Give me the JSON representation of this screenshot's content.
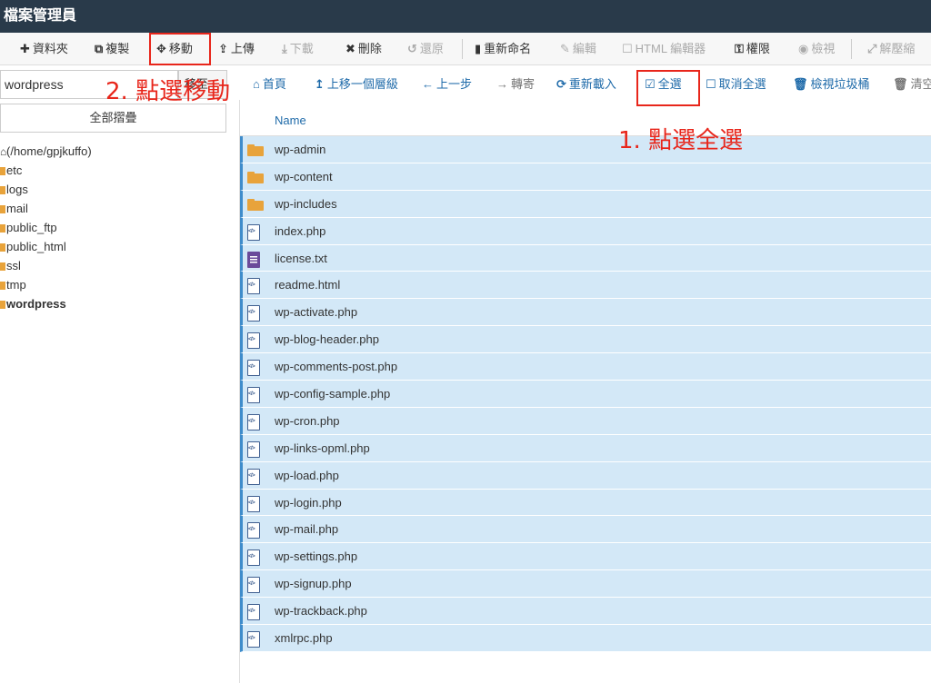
{
  "app": {
    "title": "檔案管理員"
  },
  "toolbar": {
    "new_folder": "資料夾",
    "copy": "複製",
    "move": "移動",
    "upload": "上傳",
    "download": "下載",
    "delete": "刪除",
    "restore": "還原",
    "rename": "重新命名",
    "edit": "編輯",
    "html_editor": "HTML 編輯器",
    "permissions": "權限",
    "view": "檢視",
    "extract": "解壓縮"
  },
  "sidebar": {
    "path_value": "wordpress",
    "go_label": "移至",
    "collapse_all": "全部摺疊",
    "tree": [
      {
        "label": "(/home/gpjkuffo)",
        "type": "home"
      },
      {
        "label": "etc",
        "type": "folder"
      },
      {
        "label": "logs",
        "type": "folder"
      },
      {
        "label": "mail",
        "type": "folder"
      },
      {
        "label": "public_ftp",
        "type": "folder"
      },
      {
        "label": "public_html",
        "type": "folder"
      },
      {
        "label": "ssl",
        "type": "folder"
      },
      {
        "label": "tmp",
        "type": "folder"
      },
      {
        "label": "wordpress",
        "type": "folder",
        "current": true
      }
    ]
  },
  "navbar": {
    "home": "首頁",
    "up_one_level": "上移一個層級",
    "back": "上一步",
    "forward": "轉寄",
    "reload": "重新載入",
    "select_all": "全選",
    "deselect_all": "取消全選",
    "view_trash": "檢視垃圾桶",
    "empty_trash": "清空"
  },
  "table": {
    "column_name": "Name",
    "rows": [
      {
        "name": "wp-admin",
        "type": "folder"
      },
      {
        "name": "wp-content",
        "type": "folder"
      },
      {
        "name": "wp-includes",
        "type": "folder"
      },
      {
        "name": "index.php",
        "type": "code"
      },
      {
        "name": "license.txt",
        "type": "text"
      },
      {
        "name": "readme.html",
        "type": "code"
      },
      {
        "name": "wp-activate.php",
        "type": "code"
      },
      {
        "name": "wp-blog-header.php",
        "type": "code"
      },
      {
        "name": "wp-comments-post.php",
        "type": "code"
      },
      {
        "name": "wp-config-sample.php",
        "type": "code"
      },
      {
        "name": "wp-cron.php",
        "type": "code"
      },
      {
        "name": "wp-links-opml.php",
        "type": "code"
      },
      {
        "name": "wp-load.php",
        "type": "code"
      },
      {
        "name": "wp-login.php",
        "type": "code"
      },
      {
        "name": "wp-mail.php",
        "type": "code"
      },
      {
        "name": "wp-settings.php",
        "type": "code"
      },
      {
        "name": "wp-signup.php",
        "type": "code"
      },
      {
        "name": "wp-trackback.php",
        "type": "code"
      },
      {
        "name": "xmlrpc.php",
        "type": "code"
      }
    ]
  },
  "annotations": {
    "step1": "1. 點選全選",
    "step2": "2. 點選移動"
  },
  "colors": {
    "titlebar": "#293a4a",
    "link": "#1e6aa9",
    "selected_row": "#d3e8f7",
    "annotation": "#e8261b",
    "folder": "#e8a33b"
  }
}
